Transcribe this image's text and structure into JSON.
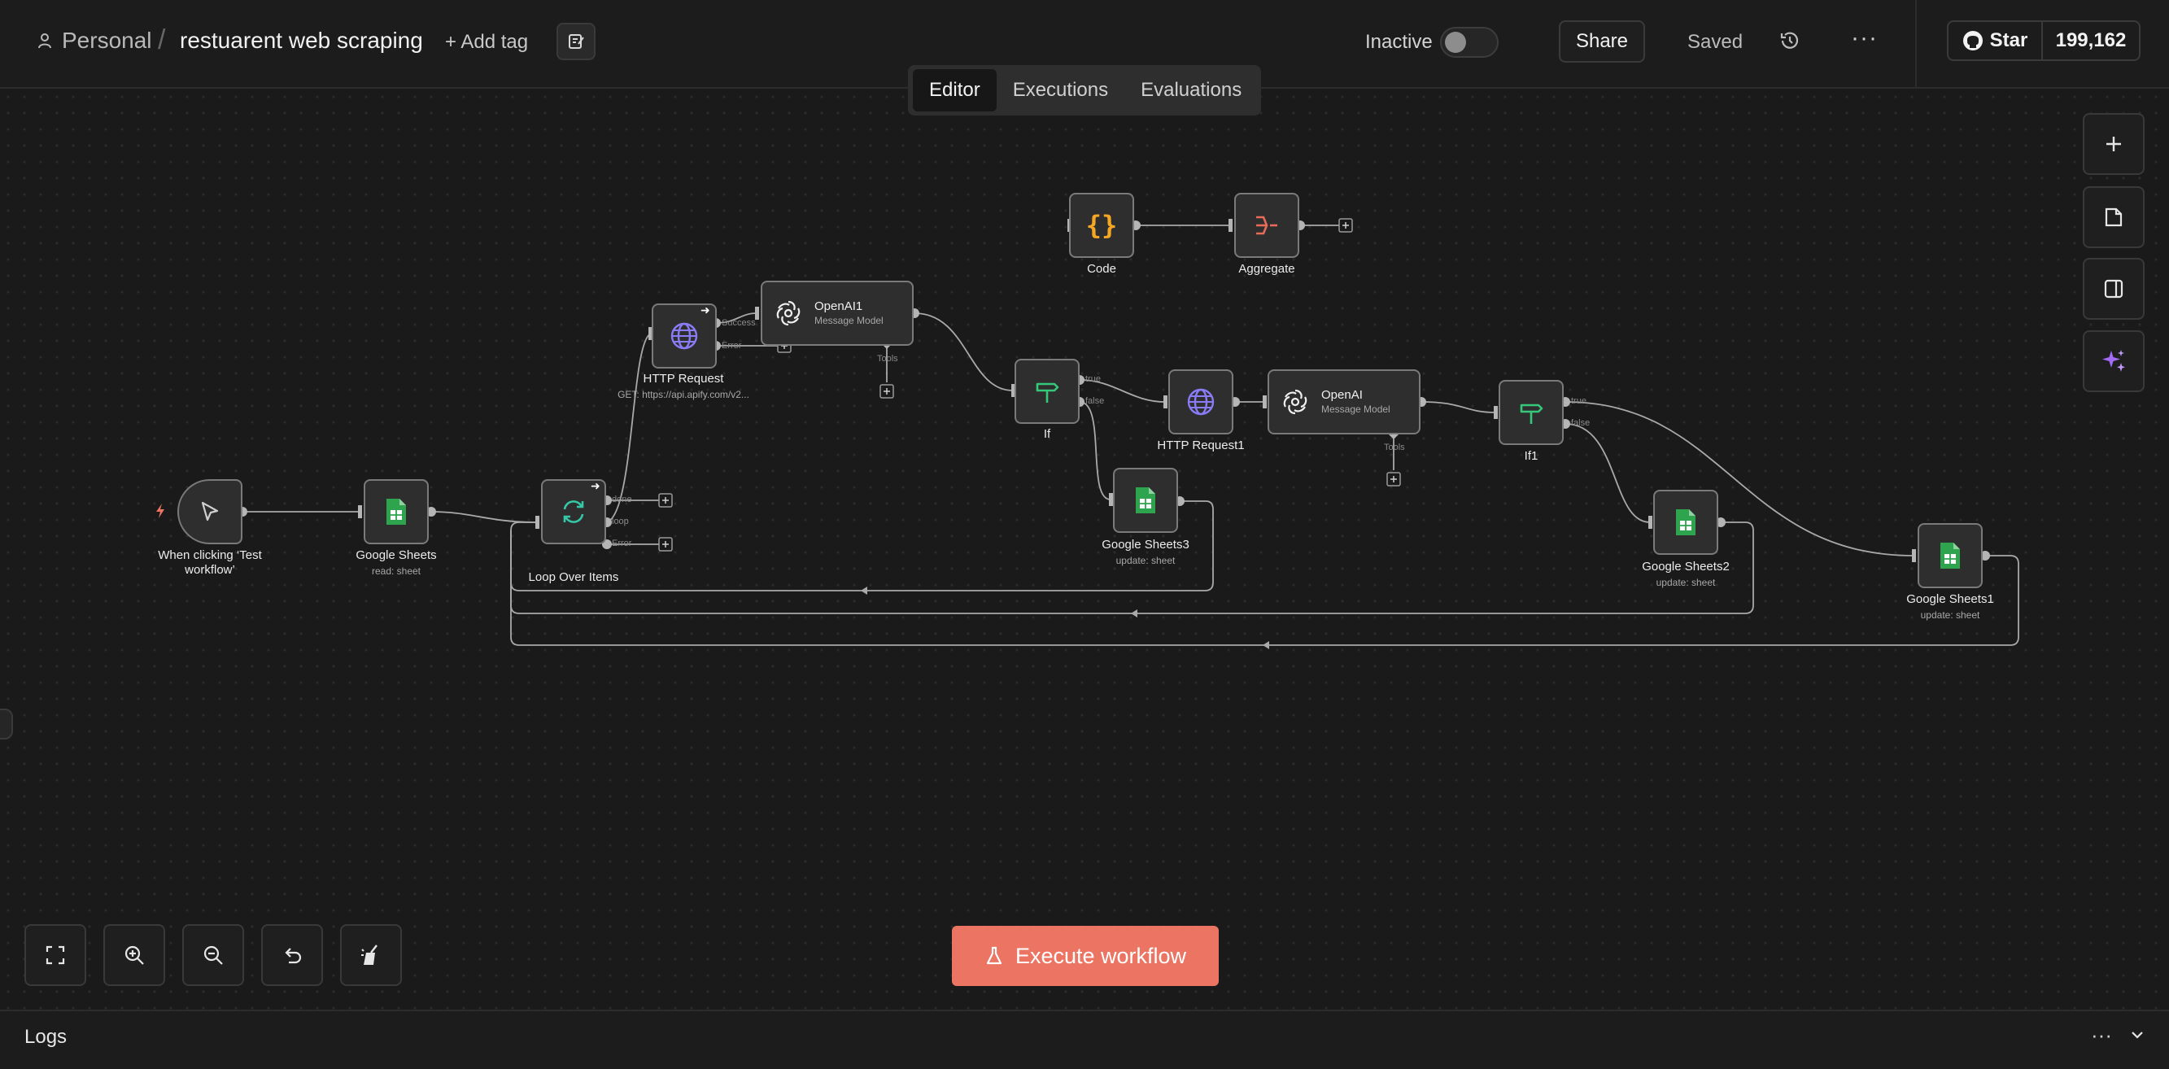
{
  "header": {
    "project": "Personal",
    "separator": "/",
    "workflow_name": "restuarent web scraping",
    "add_tag": "+ Add tag",
    "status_label": "Inactive",
    "share": "Share",
    "saved": "Saved",
    "more": "···",
    "star_label": "Star",
    "star_count": "199,162"
  },
  "tabs": [
    {
      "label": "Editor",
      "active": true
    },
    {
      "label": "Executions",
      "active": false
    },
    {
      "label": "Evaluations",
      "active": false
    }
  ],
  "nodes": {
    "trigger": {
      "label": "When clicking ‘Test workflow’"
    },
    "sheets_read": {
      "label": "Google Sheets",
      "sub": "read: sheet"
    },
    "loop": {
      "label": "Loop Over Items",
      "port_done": "done",
      "port_loop": "loop",
      "port_error": "Error"
    },
    "http": {
      "label": "HTTP Request",
      "sub": "GET: https://api.apify.com/v2...",
      "port_success": "Success",
      "port_error": "Error"
    },
    "openai1": {
      "title": "OpenAI1",
      "sub": "Message Model",
      "port_tools": "Tools"
    },
    "if": {
      "label": "If",
      "port_true": "true",
      "port_false": "false"
    },
    "http1": {
      "label": "HTTP Request1"
    },
    "openai": {
      "title": "OpenAI",
      "sub": "Message Model",
      "port_tools": "Tools"
    },
    "if1": {
      "label": "If1",
      "port_true": "true",
      "port_false": "false"
    },
    "sheets3": {
      "label": "Google Sheets3",
      "sub": "update: sheet"
    },
    "sheets2": {
      "label": "Google Sheets2",
      "sub": "update: sheet"
    },
    "sheets1": {
      "label": "Google Sheets1",
      "sub": "update: sheet"
    },
    "code": {
      "label": "Code"
    },
    "aggregate": {
      "label": "Aggregate"
    }
  },
  "execute_button": "Execute workflow",
  "logs": {
    "title": "Logs",
    "more": "···"
  },
  "icons": {
    "user": "user-icon",
    "description": "edit-description-icon",
    "history": "history-icon",
    "github": "github-icon",
    "plus": "plus-icon",
    "sticky": "sticky-note-icon",
    "panel": "panel-icon",
    "ai": "sparkles-icon",
    "fit": "fit-view-icon",
    "zoom_in": "zoom-in-icon",
    "zoom_out": "zoom-out-icon",
    "undo": "undo-icon",
    "tidy": "tidy-up-icon",
    "flask": "flask-icon",
    "chevron": "chevron-down-icon"
  },
  "colors": {
    "accent": "#ec7463",
    "sheets": "#2ea44f",
    "http": "#7b6cf0",
    "if": "#35c87a",
    "code": "#f5a623",
    "aggregate": "#e86b5a"
  }
}
